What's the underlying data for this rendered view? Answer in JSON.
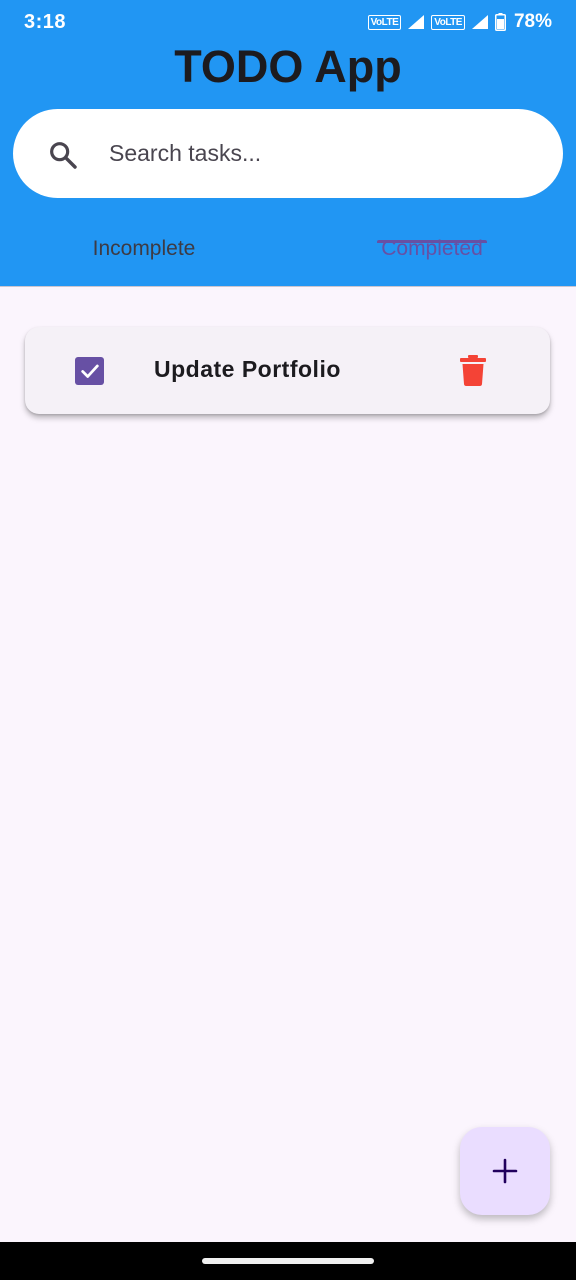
{
  "status_bar": {
    "time": "3:18",
    "network_label_1": "VoLTE",
    "network_label_2": "VoLTE",
    "battery": "78%"
  },
  "app": {
    "title": "TODO App"
  },
  "search": {
    "placeholder": "Search tasks...",
    "value": "",
    "icon": "search-icon"
  },
  "tabs": [
    {
      "label": "Incomplete",
      "selected": false
    },
    {
      "label": "Completed",
      "selected": true
    }
  ],
  "tasks": [
    {
      "title": "Update Portfolio",
      "completed": true
    }
  ],
  "fab": {
    "icon": "plus-icon"
  },
  "colors": {
    "app_bar": "#2196f3",
    "accent": "#6750a4",
    "delete": "#f44336",
    "background": "#fbf5fd",
    "fab": "#eaddff"
  }
}
